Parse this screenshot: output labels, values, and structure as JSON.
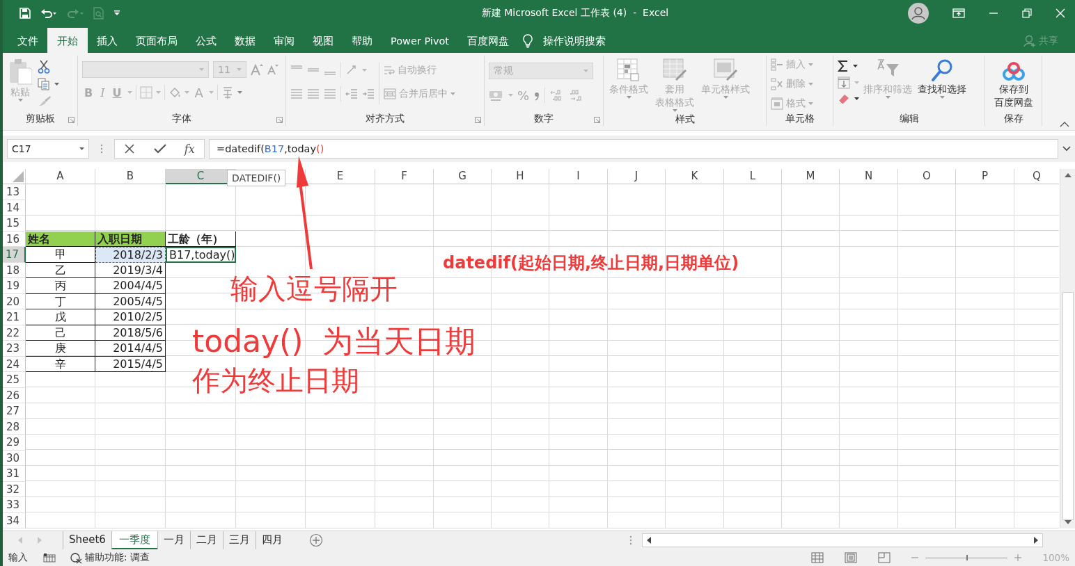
{
  "window": {
    "title": "新建 Microsoft Excel 工作表 (4)  -  Excel"
  },
  "menu_tabs": [
    {
      "label": "文件",
      "selected": false
    },
    {
      "label": "开始",
      "selected": true
    },
    {
      "label": "插入",
      "selected": false
    },
    {
      "label": "页面布局",
      "selected": false
    },
    {
      "label": "公式",
      "selected": false
    },
    {
      "label": "数据",
      "selected": false
    },
    {
      "label": "审阅",
      "selected": false
    },
    {
      "label": "视图",
      "selected": false
    },
    {
      "label": "帮助",
      "selected": false
    },
    {
      "label": "Power Pivot",
      "selected": false
    },
    {
      "label": "百度网盘",
      "selected": false
    }
  ],
  "tell_me": "操作说明搜索",
  "share": "共享",
  "ribbon": {
    "clipboard": {
      "label": "剪贴板",
      "paste": "粘贴",
      "disabled": true
    },
    "font": {
      "label": "字体",
      "size": "11",
      "bold": "B",
      "italic": "I",
      "underline": "U",
      "font_color": "A",
      "disabled": true
    },
    "alignment": {
      "label": "对齐方式",
      "wrap": "自动换行",
      "merge": "合并后居中",
      "disabled": true
    },
    "number": {
      "label": "数字",
      "format": "常规",
      "percent": "%",
      "disabled": true
    },
    "styles": {
      "label": "样式",
      "buttons": [
        {
          "lines": [
            "条件格式"
          ],
          "disabled": true
        },
        {
          "lines": [
            "套用",
            "表格格式"
          ],
          "disabled": true
        },
        {
          "lines": [
            "单元格样式"
          ],
          "disabled": true
        }
      ]
    },
    "cells": {
      "label": "单元格",
      "buttons": [
        {
          "label": "插入",
          "disabled": true
        },
        {
          "label": "删除",
          "disabled": true
        },
        {
          "label": "格式",
          "disabled": true
        }
      ]
    },
    "editing": {
      "label": "编辑",
      "buttons": [
        {
          "lines": [
            "排序和筛选"
          ],
          "disabled": true
        },
        {
          "lines": [
            "查找和选择"
          ],
          "disabled": false
        }
      ]
    },
    "save": {
      "label": "保存",
      "buttons": [
        {
          "lines": [
            "保存到",
            "百度网盘"
          ],
          "disabled": false
        }
      ]
    }
  },
  "formula_bar": {
    "name_box": "C17",
    "fx": "fx",
    "segments": [
      {
        "text": "=datedif(",
        "color": "#222222"
      },
      {
        "text": "B17",
        "color": "#3a6fd0"
      },
      {
        "text": ",today",
        "color": "#222222"
      },
      {
        "text": "()",
        "color": "#e0403a"
      }
    ]
  },
  "tooltip": "DATEDIF()",
  "columns": [
    {
      "label": "A",
      "selected": false
    },
    {
      "label": "B",
      "selected": false
    },
    {
      "label": "C",
      "selected": true
    },
    {
      "selected": false
    },
    {
      "label": "E",
      "selected": false
    },
    {
      "label": "F",
      "selected": false
    },
    {
      "label": "G",
      "selected": false
    },
    {
      "label": "H",
      "selected": false
    },
    {
      "label": "I",
      "selected": false
    },
    {
      "label": "J",
      "selected": false
    },
    {
      "label": "K",
      "selected": false
    },
    {
      "label": "L",
      "selected": false
    },
    {
      "label": "M",
      "selected": false
    },
    {
      "label": "N",
      "selected": false
    },
    {
      "label": "O",
      "selected": false
    },
    {
      "label": "P",
      "selected": false
    },
    {
      "label": "Q",
      "selected": false
    }
  ],
  "rows": [
    {
      "number": "13",
      "selected": false
    },
    {
      "number": "14",
      "selected": false
    },
    {
      "number": "15",
      "selected": false
    },
    {
      "number": "16",
      "selected": false,
      "cells": [
        {
          "text": "姓名",
          "kind": "header",
          "color": "#92d050"
        },
        {
          "text": "入职日期",
          "kind": "header",
          "color": "#92d050"
        },
        {
          "text": "工龄（年）",
          "kind": "header"
        }
      ]
    },
    {
      "number": "17",
      "selected": true,
      "cells": [
        {
          "text": "甲",
          "kind": "name"
        },
        {
          "text": "2018/2/3",
          "kind": "reference"
        },
        {
          "text": "B17,today()",
          "kind": "editing"
        }
      ]
    },
    {
      "number": "18",
      "selected": false,
      "cells": [
        {
          "text": "乙",
          "kind": "name"
        },
        {
          "text": "2019/3/4",
          "kind": "date"
        }
      ]
    },
    {
      "number": "19",
      "selected": false,
      "cells": [
        {
          "text": "丙",
          "kind": "name"
        },
        {
          "text": "2004/4/5",
          "kind": "date"
        }
      ]
    },
    {
      "number": "20",
      "selected": false,
      "cells": [
        {
          "text": "丁",
          "kind": "name"
        },
        {
          "text": "2005/4/5",
          "kind": "date"
        }
      ]
    },
    {
      "number": "21",
      "selected": false,
      "cells": [
        {
          "text": "戊",
          "kind": "name"
        },
        {
          "text": "2010/2/5",
          "kind": "date"
        }
      ]
    },
    {
      "number": "22",
      "selected": false,
      "cells": [
        {
          "text": "己",
          "kind": "name"
        },
        {
          "text": "2018/5/6",
          "kind": "date"
        }
      ]
    },
    {
      "number": "23",
      "selected": false,
      "cells": [
        {
          "text": "庚",
          "kind": "name"
        },
        {
          "text": "2014/4/5",
          "kind": "date"
        }
      ]
    },
    {
      "number": "24",
      "selected": false,
      "cells": [
        {
          "text": "辛",
          "kind": "name"
        },
        {
          "text": "2015/4/5",
          "kind": "date"
        }
      ]
    },
    {
      "number": "25",
      "selected": false
    },
    {
      "number": "26",
      "selected": false
    },
    {
      "number": "27",
      "selected": false
    },
    {
      "number": "28",
      "selected": false
    },
    {
      "number": "29",
      "selected": false
    },
    {
      "number": "30",
      "selected": false
    },
    {
      "number": "31",
      "selected": false
    },
    {
      "number": "32",
      "selected": false
    },
    {
      "number": "33",
      "selected": false
    },
    {
      "number": "34",
      "selected": false
    }
  ],
  "annotations": [
    {
      "text": "datedif(起始日期,终止日期,日期单位)",
      "kind": "bold"
    },
    {
      "text": "输入逗号隔开",
      "kind": "large"
    },
    {
      "text": "today()  为当天日期",
      "kind": "large"
    },
    {
      "text": "作为终止日期",
      "kind": "large"
    }
  ],
  "sheet_tabs": [
    {
      "label": "Sheet6",
      "selected": false
    },
    {
      "label": "一季度",
      "selected": true
    },
    {
      "label": "一月",
      "selected": false
    },
    {
      "label": "二月",
      "selected": false
    },
    {
      "label": "三月",
      "selected": false
    },
    {
      "label": "四月",
      "selected": false
    }
  ],
  "status_bar": {
    "mode": "输入",
    "accessibility": "辅助功能: 调查",
    "zoom": {
      "level": 0.5,
      "reading": "100%"
    }
  }
}
